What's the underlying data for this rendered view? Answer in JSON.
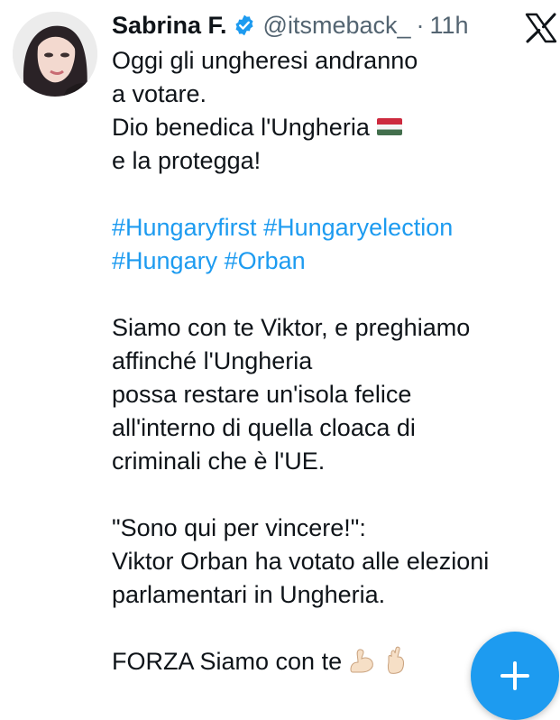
{
  "author": {
    "display_name": "Sabrina F.",
    "handle": "@itsmeback_",
    "separator": "·",
    "time": "11h",
    "avatar_icon": "profile-avatar",
    "verified_icon": "verified-badge-icon"
  },
  "tweet": {
    "lines": [
      "Oggi gli ungheresi andranno",
      "a votare.",
      "Dio benedica l'Ungheria",
      "e la protegga!"
    ],
    "hashtags_line1": [
      "#Hungaryfirst",
      "#Hungaryelection"
    ],
    "hashtags_line2": [
      "#Hungary",
      "#Orban"
    ],
    "paragraph2": [
      "Siamo con te Viktor, e preghiamo",
      "affinché l'Ungheria",
      "possa restare un'isola felice",
      "all'interno di quella cloaca di",
      "criminali che è l'UE."
    ],
    "paragraph3": [
      "\"Sono qui per vincere!\":",
      "Viktor Orban ha votato alle elezioni",
      "parlamentari in Ungheria."
    ],
    "closing": "FORZA Siamo con te",
    "flag_icon": "hungary-flag-emoji",
    "emoji_icons": [
      "flexed-biceps-emoji",
      "crossed-fingers-emoji"
    ]
  },
  "toolbar": {
    "logo_icon": "x-logo-icon",
    "compose_icon": "plus-icon"
  },
  "colors": {
    "text": "#0f1419",
    "secondary": "#536471",
    "link": "#1d9bf0",
    "fab": "#1d9bf0"
  }
}
